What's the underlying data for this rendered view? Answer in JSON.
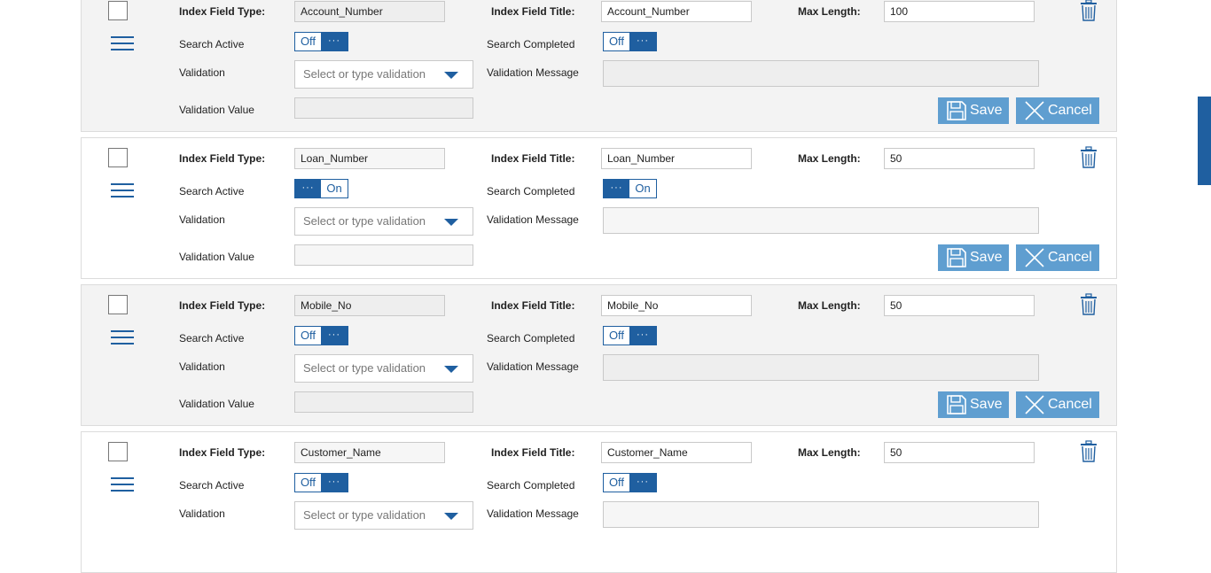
{
  "labels": {
    "index_field_type": "Index Field Type:",
    "index_field_title": "Index Field Title:",
    "max_length": "Max Length:",
    "search_active": "Search Active",
    "search_completed": "Search Completed",
    "validation": "Validation",
    "validation_message": "Validation Message",
    "validation_value": "Validation Value",
    "select_placeholder": "Select or type validation",
    "save": "Save",
    "cancel": "Cancel",
    "off": "Off",
    "on": "On",
    "dots": "···"
  },
  "colors": {
    "accent": "#1f5fa0",
    "button": "#5f9ed0",
    "card_shaded": "#f3f3f3"
  },
  "rows": [
    {
      "field_type": "Account_Number",
      "field_title": "Account_Number",
      "max_length": "100",
      "search_active": "Off",
      "search_completed": "Off",
      "buttons_visible": true
    },
    {
      "field_type": "Loan_Number",
      "field_title": "Loan_Number",
      "max_length": "50",
      "search_active": "On",
      "search_completed": "On",
      "buttons_visible": true
    },
    {
      "field_type": "Mobile_No",
      "field_title": "Mobile_No",
      "max_length": "50",
      "search_active": "Off",
      "search_completed": "Off",
      "buttons_visible": true
    },
    {
      "field_type": "Customer_Name",
      "field_title": "Customer_Name",
      "max_length": "50",
      "search_active": "Off",
      "search_completed": "Off",
      "buttons_visible": false
    }
  ]
}
